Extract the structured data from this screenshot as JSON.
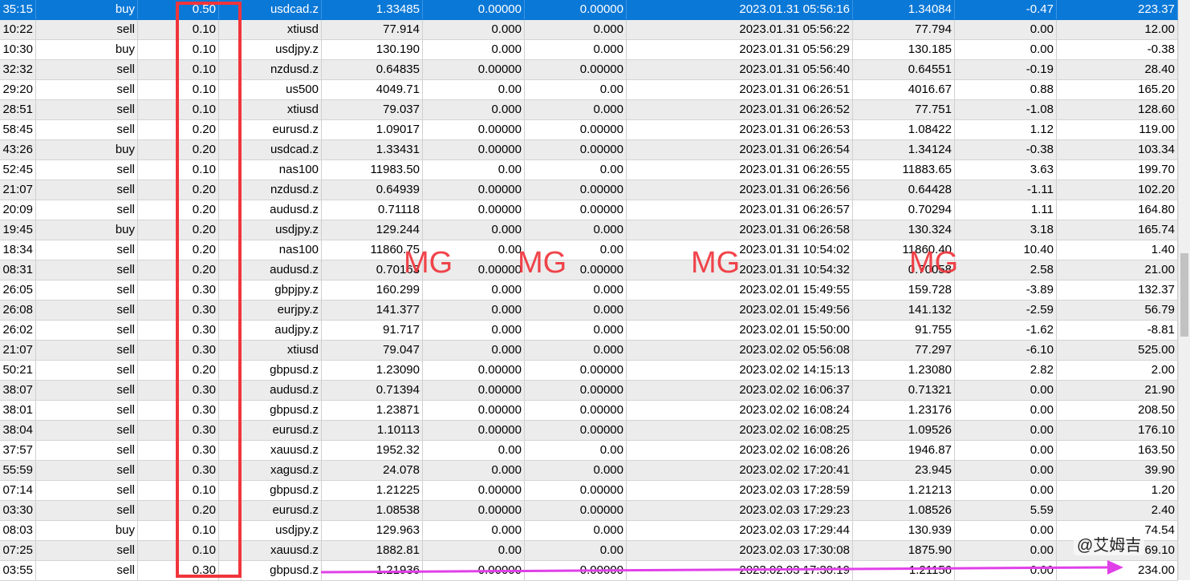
{
  "rows": [
    {
      "time": "35:15",
      "type": "buy",
      "volume": "0.50",
      "symbol": "usdcad.z",
      "open_price": "1.33485",
      "sl": "0.00000",
      "tp": "0.00000",
      "close_time": "2023.01.31 05:56:16",
      "close_price": "1.34084",
      "swap": "-0.47",
      "profit": "223.37"
    },
    {
      "time": "10:22",
      "type": "sell",
      "volume": "0.10",
      "symbol": "xtiusd",
      "open_price": "77.914",
      "sl": "0.000",
      "tp": "0.000",
      "close_time": "2023.01.31 05:56:22",
      "close_price": "77.794",
      "swap": "0.00",
      "profit": "12.00"
    },
    {
      "time": "10:30",
      "type": "buy",
      "volume": "0.10",
      "symbol": "usdjpy.z",
      "open_price": "130.190",
      "sl": "0.000",
      "tp": "0.000",
      "close_time": "2023.01.31 05:56:29",
      "close_price": "130.185",
      "swap": "0.00",
      "profit": "-0.38"
    },
    {
      "time": "32:32",
      "type": "sell",
      "volume": "0.10",
      "symbol": "nzdusd.z",
      "open_price": "0.64835",
      "sl": "0.00000",
      "tp": "0.00000",
      "close_time": "2023.01.31 05:56:40",
      "close_price": "0.64551",
      "swap": "-0.19",
      "profit": "28.40"
    },
    {
      "time": "29:20",
      "type": "sell",
      "volume": "0.10",
      "symbol": "us500",
      "open_price": "4049.71",
      "sl": "0.00",
      "tp": "0.00",
      "close_time": "2023.01.31 06:26:51",
      "close_price": "4016.67",
      "swap": "0.88",
      "profit": "165.20"
    },
    {
      "time": "28:51",
      "type": "sell",
      "volume": "0.10",
      "symbol": "xtiusd",
      "open_price": "79.037",
      "sl": "0.000",
      "tp": "0.000",
      "close_time": "2023.01.31 06:26:52",
      "close_price": "77.751",
      "swap": "-1.08",
      "profit": "128.60"
    },
    {
      "time": "58:45",
      "type": "sell",
      "volume": "0.20",
      "symbol": "eurusd.z",
      "open_price": "1.09017",
      "sl": "0.00000",
      "tp": "0.00000",
      "close_time": "2023.01.31 06:26:53",
      "close_price": "1.08422",
      "swap": "1.12",
      "profit": "119.00"
    },
    {
      "time": "43:26",
      "type": "buy",
      "volume": "0.20",
      "symbol": "usdcad.z",
      "open_price": "1.33431",
      "sl": "0.00000",
      "tp": "0.00000",
      "close_time": "2023.01.31 06:26:54",
      "close_price": "1.34124",
      "swap": "-0.38",
      "profit": "103.34"
    },
    {
      "time": "52:45",
      "type": "sell",
      "volume": "0.10",
      "symbol": "nas100",
      "open_price": "11983.50",
      "sl": "0.00",
      "tp": "0.00",
      "close_time": "2023.01.31 06:26:55",
      "close_price": "11883.65",
      "swap": "3.63",
      "profit": "199.70"
    },
    {
      "time": "21:07",
      "type": "sell",
      "volume": "0.20",
      "symbol": "nzdusd.z",
      "open_price": "0.64939",
      "sl": "0.00000",
      "tp": "0.00000",
      "close_time": "2023.01.31 06:26:56",
      "close_price": "0.64428",
      "swap": "-1.11",
      "profit": "102.20"
    },
    {
      "time": "20:09",
      "type": "sell",
      "volume": "0.20",
      "symbol": "audusd.z",
      "open_price": "0.71118",
      "sl": "0.00000",
      "tp": "0.00000",
      "close_time": "2023.01.31 06:26:57",
      "close_price": "0.70294",
      "swap": "1.11",
      "profit": "164.80"
    },
    {
      "time": "19:45",
      "type": "buy",
      "volume": "0.20",
      "symbol": "usdjpy.z",
      "open_price": "129.244",
      "sl": "0.000",
      "tp": "0.000",
      "close_time": "2023.01.31 06:26:58",
      "close_price": "130.324",
      "swap": "3.18",
      "profit": "165.74"
    },
    {
      "time": "18:34",
      "type": "sell",
      "volume": "0.20",
      "symbol": "nas100",
      "open_price": "11860.75",
      "sl": "0.00",
      "tp": "0.00",
      "close_time": "2023.01.31 10:54:02",
      "close_price": "11860.40",
      "swap": "10.40",
      "profit": "1.40"
    },
    {
      "time": "08:31",
      "type": "sell",
      "volume": "0.20",
      "symbol": "audusd.z",
      "open_price": "0.70163",
      "sl": "0.00000",
      "tp": "0.00000",
      "close_time": "2023.01.31 10:54:32",
      "close_price": "0.70058",
      "swap": "2.58",
      "profit": "21.00"
    },
    {
      "time": "26:05",
      "type": "sell",
      "volume": "0.30",
      "symbol": "gbpjpy.z",
      "open_price": "160.299",
      "sl": "0.000",
      "tp": "0.000",
      "close_time": "2023.02.01 15:49:55",
      "close_price": "159.728",
      "swap": "-3.89",
      "profit": "132.37"
    },
    {
      "time": "26:08",
      "type": "sell",
      "volume": "0.30",
      "symbol": "eurjpy.z",
      "open_price": "141.377",
      "sl": "0.000",
      "tp": "0.000",
      "close_time": "2023.02.01 15:49:56",
      "close_price": "141.132",
      "swap": "-2.59",
      "profit": "56.79"
    },
    {
      "time": "26:02",
      "type": "sell",
      "volume": "0.30",
      "symbol": "audjpy.z",
      "open_price": "91.717",
      "sl": "0.000",
      "tp": "0.000",
      "close_time": "2023.02.01 15:50:00",
      "close_price": "91.755",
      "swap": "-1.62",
      "profit": "-8.81"
    },
    {
      "time": "21:07",
      "type": "sell",
      "volume": "0.30",
      "symbol": "xtiusd",
      "open_price": "79.047",
      "sl": "0.000",
      "tp": "0.000",
      "close_time": "2023.02.02 05:56:08",
      "close_price": "77.297",
      "swap": "-6.10",
      "profit": "525.00"
    },
    {
      "time": "50:21",
      "type": "sell",
      "volume": "0.20",
      "symbol": "gbpusd.z",
      "open_price": "1.23090",
      "sl": "0.00000",
      "tp": "0.00000",
      "close_time": "2023.02.02 14:15:13",
      "close_price": "1.23080",
      "swap": "2.82",
      "profit": "2.00"
    },
    {
      "time": "38:07",
      "type": "sell",
      "volume": "0.30",
      "symbol": "audusd.z",
      "open_price": "0.71394",
      "sl": "0.00000",
      "tp": "0.00000",
      "close_time": "2023.02.02 16:06:37",
      "close_price": "0.71321",
      "swap": "0.00",
      "profit": "21.90"
    },
    {
      "time": "38:01",
      "type": "sell",
      "volume": "0.30",
      "symbol": "gbpusd.z",
      "open_price": "1.23871",
      "sl": "0.00000",
      "tp": "0.00000",
      "close_time": "2023.02.02 16:08:24",
      "close_price": "1.23176",
      "swap": "0.00",
      "profit": "208.50"
    },
    {
      "time": "38:04",
      "type": "sell",
      "volume": "0.30",
      "symbol": "eurusd.z",
      "open_price": "1.10113",
      "sl": "0.00000",
      "tp": "0.00000",
      "close_time": "2023.02.02 16:08:25",
      "close_price": "1.09526",
      "swap": "0.00",
      "profit": "176.10"
    },
    {
      "time": "37:57",
      "type": "sell",
      "volume": "0.30",
      "symbol": "xauusd.z",
      "open_price": "1952.32",
      "sl": "0.00",
      "tp": "0.00",
      "close_time": "2023.02.02 16:08:26",
      "close_price": "1946.87",
      "swap": "0.00",
      "profit": "163.50"
    },
    {
      "time": "55:59",
      "type": "sell",
      "volume": "0.30",
      "symbol": "xagusd.z",
      "open_price": "24.078",
      "sl": "0.000",
      "tp": "0.000",
      "close_time": "2023.02.02 17:20:41",
      "close_price": "23.945",
      "swap": "0.00",
      "profit": "39.90"
    },
    {
      "time": "07:14",
      "type": "sell",
      "volume": "0.10",
      "symbol": "gbpusd.z",
      "open_price": "1.21225",
      "sl": "0.00000",
      "tp": "0.00000",
      "close_time": "2023.02.03 17:28:59",
      "close_price": "1.21213",
      "swap": "0.00",
      "profit": "1.20"
    },
    {
      "time": "03:30",
      "type": "sell",
      "volume": "0.20",
      "symbol": "eurusd.z",
      "open_price": "1.08538",
      "sl": "0.00000",
      "tp": "0.00000",
      "close_time": "2023.02.03 17:29:23",
      "close_price": "1.08526",
      "swap": "5.59",
      "profit": "2.40"
    },
    {
      "time": "08:03",
      "type": "buy",
      "volume": "0.10",
      "symbol": "usdjpy.z",
      "open_price": "129.963",
      "sl": "0.000",
      "tp": "0.000",
      "close_time": "2023.02.03 17:29:44",
      "close_price": "130.939",
      "swap": "0.00",
      "profit": "74.54"
    },
    {
      "time": "07:25",
      "type": "sell",
      "volume": "0.10",
      "symbol": "xauusd.z",
      "open_price": "1882.81",
      "sl": "0.00",
      "tp": "0.00",
      "close_time": "2023.02.03 17:30:08",
      "close_price": "1875.90",
      "swap": "0.00",
      "profit": "69.10"
    },
    {
      "time": "03:55",
      "type": "sell",
      "volume": "0.30",
      "symbol": "gbpusd.z",
      "open_price": "1.21936",
      "sl": "0.00000",
      "tp": "0.00000",
      "close_time": "2023.02.03 17:30:19",
      "close_price": "1.21156",
      "swap": "0.00",
      "profit": "234.00"
    }
  ],
  "watermarks": [
    "MG",
    "MG",
    "MG",
    "MG"
  ],
  "author_badge": "@艾姆吉",
  "colors": {
    "selected_row": "#0a78d7",
    "alt_row": "#ececec",
    "annotation_red": "#f0353c",
    "annotation_magenta": "#e040e8"
  },
  "selected_row_index": 0
}
